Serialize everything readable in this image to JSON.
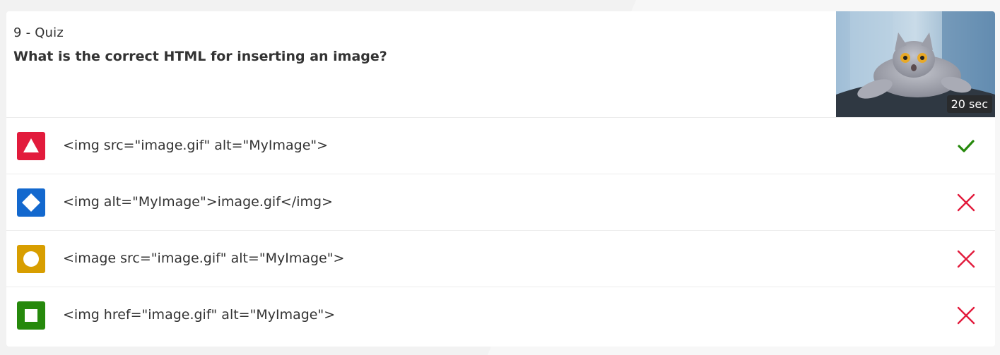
{
  "quiz": {
    "number_label": "9 - Quiz",
    "question": "What is the correct HTML for inserting an image?",
    "time_limit": "20 sec"
  },
  "answers": [
    {
      "text": "<img src=\"image.gif\" alt=\"MyImage\">",
      "shape": "triangle-icon",
      "color": "#e21b3c",
      "correct": true
    },
    {
      "text": "<img alt=\"MyImage\">image.gif</img>",
      "shape": "diamond-icon",
      "color": "#1368ce",
      "correct": false
    },
    {
      "text": "<image src=\"image.gif\" alt=\"MyImage\">",
      "shape": "circle-icon",
      "color": "#d89e00",
      "correct": false
    },
    {
      "text": "<img href=\"image.gif\" alt=\"MyImage\">",
      "shape": "square-icon",
      "color": "#26890c",
      "correct": false
    }
  ],
  "colors": {
    "correct": "#26890c",
    "incorrect": "#e21b3c"
  }
}
